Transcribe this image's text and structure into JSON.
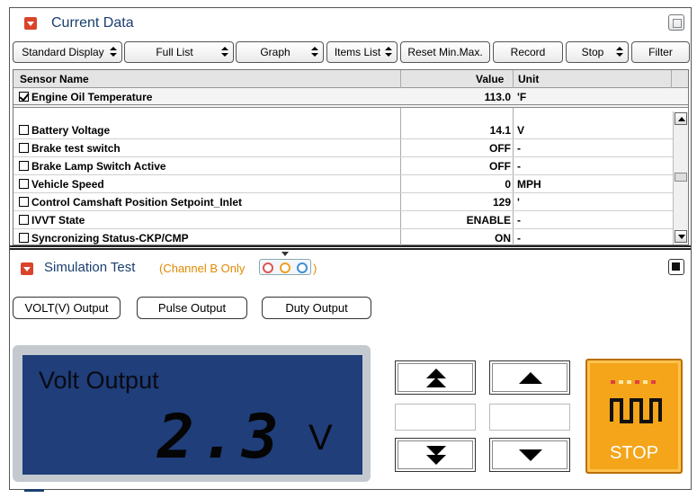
{
  "current_data": {
    "title": "Current Data",
    "toolbar": {
      "standard_display": "Standard Display",
      "full_list": "Full List",
      "graph": "Graph",
      "items_list": "Items List",
      "reset_min_max": "Reset Min.Max.",
      "record": "Record",
      "stop": "Stop",
      "filter": "Filter"
    },
    "columns": {
      "sensor_name": "Sensor Name",
      "value": "Value",
      "unit": "Unit"
    },
    "pinned_row": {
      "name": "Engine Oil Temperature",
      "value": "113.0",
      "unit": "'F",
      "checked": true
    },
    "rows": [
      {
        "name": "Battery Voltage",
        "value": "14.1",
        "unit": "V",
        "checked": false
      },
      {
        "name": "Brake test switch",
        "value": "OFF",
        "unit": "-",
        "checked": false
      },
      {
        "name": "Brake Lamp Switch Active",
        "value": "OFF",
        "unit": "-",
        "checked": false
      },
      {
        "name": "Vehicle Speed",
        "value": "0",
        "unit": "MPH",
        "checked": false
      },
      {
        "name": "Control Camshaft Position Setpoint_Inlet",
        "value": "129",
        "unit": "'",
        "checked": false
      },
      {
        "name": "IVVT State",
        "value": "ENABLE",
        "unit": "-",
        "checked": false
      },
      {
        "name": "Syncronizing Status-CKP/CMP",
        "value": "ON",
        "unit": "-",
        "checked": false
      }
    ]
  },
  "simulation": {
    "title": "Simulation Test",
    "subtitle_open": "(Channel B Only",
    "subtitle_close": ")",
    "modes": {
      "volt": "VOLT(V) Output",
      "pulse": "Pulse Output",
      "duty": "Duty Output"
    },
    "display": {
      "title": "Volt Output",
      "value": "2.3",
      "unit": "V"
    },
    "stop_label": "STOP",
    "colors": {
      "accent_orange": "#f4a51a",
      "lcd_blue": "#1f3e7a",
      "header_blue": "#1a3e6e",
      "dot_red": "#e05252",
      "dot_orange": "#f0a020",
      "dot_blue": "#3b8fd6"
    }
  }
}
